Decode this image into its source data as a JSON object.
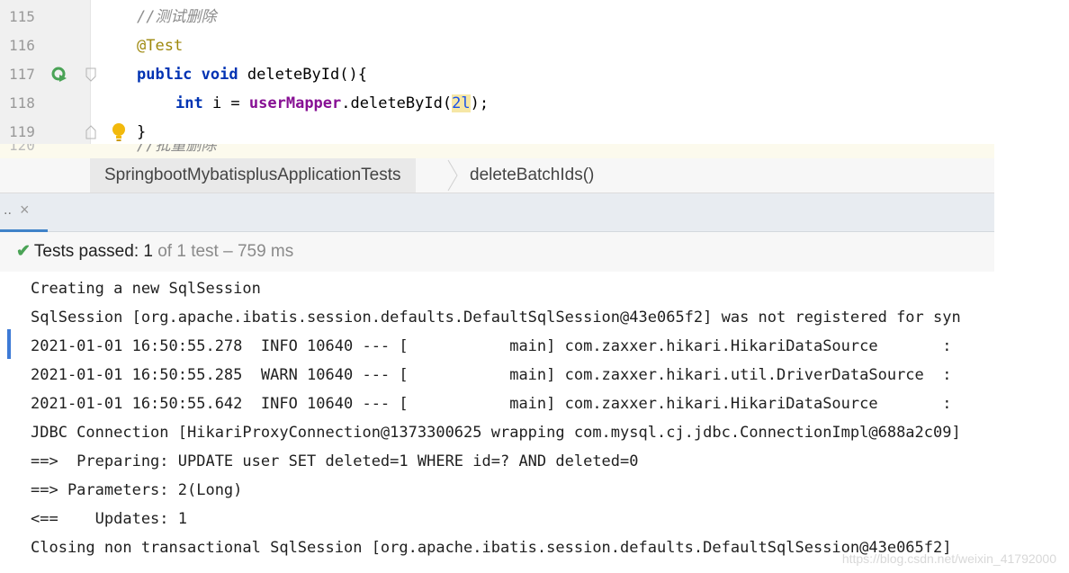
{
  "editor": {
    "lines": [
      {
        "num": "115",
        "comment": "//测试删除"
      },
      {
        "num": "116",
        "annotation": "@Test"
      },
      {
        "num": "117",
        "kw1": "public",
        "kw2": "void",
        "method": "deleteById(){"
      },
      {
        "num": "118",
        "kw": "int",
        "var": " i = ",
        "field": "userMapper",
        "call": ".deleteById(",
        "arg": "2l",
        "end": ");"
      },
      {
        "num": "119",
        "brace": "}"
      }
    ],
    "partial_comment": "//批量删除"
  },
  "breadcrumb": {
    "class_name": "SpringbootMybatisplusApplicationTests",
    "method_name": "deleteBatchIds()"
  },
  "run_tab": {
    "label": "..",
    "close_glyph": "×"
  },
  "status": {
    "prefix": "Tests passed: ",
    "passed": "1",
    "suffix": " of 1 test – 759 ms"
  },
  "console_lines": [
    "Creating a new SqlSession",
    "SqlSession [org.apache.ibatis.session.defaults.DefaultSqlSession@43e065f2] was not registered for syn",
    "2021-01-01 16:50:55.278  INFO 10640 --- [           main] com.zaxxer.hikari.HikariDataSource       :",
    "2021-01-01 16:50:55.285  WARN 10640 --- [           main] com.zaxxer.hikari.util.DriverDataSource  :",
    "2021-01-01 16:50:55.642  INFO 10640 --- [           main] com.zaxxer.hikari.HikariDataSource       :",
    "JDBC Connection [HikariProxyConnection@1373300625 wrapping com.mysql.cj.jdbc.ConnectionImpl@688a2c09]",
    "==>  Preparing: UPDATE user SET deleted=1 WHERE id=? AND deleted=0",
    "==> Parameters: 2(Long)",
    "<==    Updates: 1",
    "Closing non transactional SqlSession [org.apache.ibatis.session.defaults.DefaultSqlSession@43e065f2]"
  ],
  "watermark": "https://blog.csdn.net/weixin_41792000",
  "colors": {
    "keyword": "#0033b3",
    "annotation": "#9e880d",
    "field": "#871094",
    "comment": "#8c8c8c",
    "pass": "#4aa356",
    "tab_accent": "#4083c9"
  },
  "icons": [
    "run-test-icon",
    "fold-icon",
    "lightbulb-icon",
    "close-icon",
    "check-icon",
    "chevron-right-icon"
  ]
}
